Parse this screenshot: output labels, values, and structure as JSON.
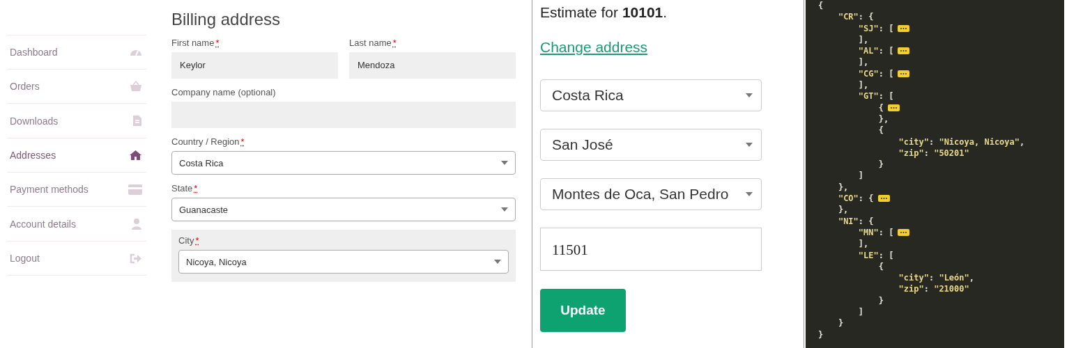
{
  "account": {
    "sidebar": {
      "items": [
        {
          "label": "Dashboard",
          "selected": false
        },
        {
          "label": "Orders",
          "selected": false
        },
        {
          "label": "Downloads",
          "selected": false
        },
        {
          "label": "Addresses",
          "selected": true
        },
        {
          "label": "Payment methods",
          "selected": false
        },
        {
          "label": "Account details",
          "selected": false
        },
        {
          "label": "Logout",
          "selected": false
        }
      ]
    },
    "billing": {
      "title": "Billing address",
      "fields": [
        {
          "kind": "text",
          "label": "First name",
          "required_mark": "*",
          "value": "Keylor"
        },
        {
          "kind": "text",
          "label": "Last name",
          "required_mark": "*",
          "value": "Mendoza"
        },
        {
          "kind": "text",
          "label": "Company name (optional)"
        },
        {
          "kind": "select",
          "label": "Country / Region",
          "required_mark": "*",
          "value": "Costa Rica"
        },
        {
          "kind": "select",
          "label": "State",
          "required_mark": "*",
          "value": "Guanacaste"
        },
        {
          "kind": "select",
          "label": "City",
          "required_mark": "*",
          "value": "Nicoya, Nicoya",
          "shaded": true
        }
      ]
    }
  },
  "estimate": {
    "text": "Estimate for **10101**.",
    "link": "Change address",
    "selects": [
      "Costa Rica",
      "San José",
      "Montes de Oca, San Pedro"
    ],
    "zip": "11501",
    "button": "Update"
  },
  "code": {
    "lines": [
      {
        "text": "{",
        "folded": false
      },
      {
        "text": "    \"CR\": {",
        "folded": false
      },
      {
        "text": "        \"SJ\": [",
        "folded": true
      },
      {
        "text": "        ],",
        "folded": false
      },
      {
        "text": "        \"AL\": [",
        "folded": true
      },
      {
        "text": "        ],",
        "folded": false
      },
      {
        "text": "        \"CG\": [",
        "folded": true
      },
      {
        "text": "        ],",
        "folded": false
      },
      {
        "text": "        \"GT\": [",
        "folded": false
      },
      {
        "text": "            {",
        "folded": true
      },
      {
        "text": "            },",
        "folded": false
      },
      {
        "text": "            {",
        "folded": false
      },
      {
        "text": "                \"city\": \"Nicoya, Nicoya\",",
        "folded": false
      },
      {
        "text": "                \"zip\": \"50201\"",
        "folded": false
      },
      {
        "text": "            }",
        "folded": false
      },
      {
        "text": "        ]",
        "folded": false
      },
      {
        "text": "    },",
        "folded": false
      },
      {
        "text": "    \"CO\": {",
        "folded": true
      },
      {
        "text": "    },",
        "folded": false
      },
      {
        "text": "    \"NI\": {",
        "folded": false
      },
      {
        "text": "        \"MN\": [",
        "folded": true
      },
      {
        "text": "        ],",
        "folded": false
      },
      {
        "text": "        \"LE\": [",
        "folded": false
      },
      {
        "text": "            {",
        "folded": false
      },
      {
        "text": "                \"city\": \"León\",",
        "folded": false
      },
      {
        "text": "                \"zip\": \"21000\"",
        "folded": false
      },
      {
        "text": "            }",
        "folded": false
      },
      {
        "text": "        ]",
        "folded": false
      },
      {
        "text": "    }",
        "folded": false
      },
      {
        "text": "}",
        "folded": false
      }
    ]
  }
}
